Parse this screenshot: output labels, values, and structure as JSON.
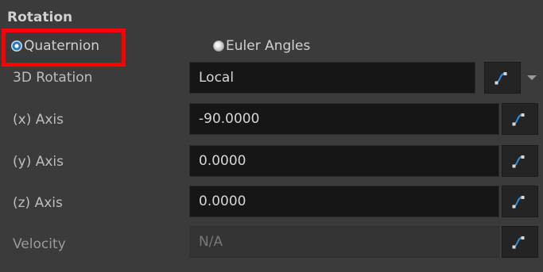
{
  "section": {
    "title": "Rotation"
  },
  "rotation_mode": {
    "quaternion_label": "Quaternion",
    "euler_label": "Euler Angles",
    "selected": "Quaternion"
  },
  "fields": [
    {
      "label": "3D Rotation",
      "value": "Local"
    },
    {
      "label": "(x) Axis",
      "value": "-90.0000"
    },
    {
      "label": "(y) Axis",
      "value": "0.0000"
    },
    {
      "label": "(z) Axis",
      "value": "0.0000"
    },
    {
      "label": "Velocity",
      "value": "N/A"
    }
  ],
  "icons": {
    "function_curve": "function-curve-icon",
    "dropdown": "dropdown-arrow-icon"
  },
  "colors": {
    "background": "#3b3b3b",
    "field_background": "#161616",
    "accent_blue": "#2f8fd8",
    "highlight_red": "#ff0000"
  }
}
